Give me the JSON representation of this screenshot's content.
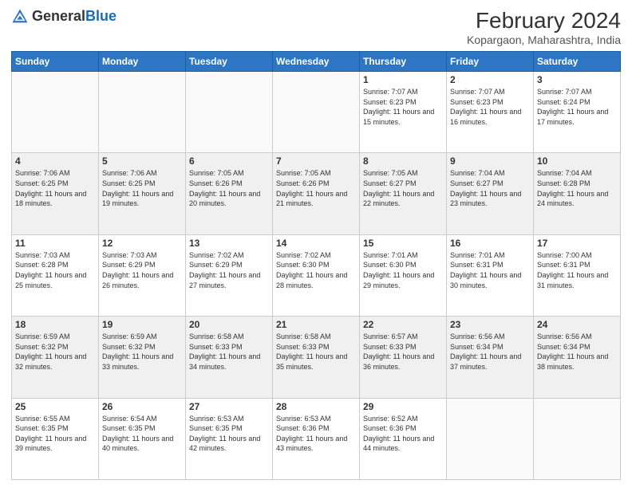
{
  "header": {
    "logo_general": "General",
    "logo_blue": "Blue",
    "month_year": "February 2024",
    "location": "Kopargaon, Maharashtra, India"
  },
  "weekdays": [
    "Sunday",
    "Monday",
    "Tuesday",
    "Wednesday",
    "Thursday",
    "Friday",
    "Saturday"
  ],
  "weeks": [
    [
      {
        "day": "",
        "info": ""
      },
      {
        "day": "",
        "info": ""
      },
      {
        "day": "",
        "info": ""
      },
      {
        "day": "",
        "info": ""
      },
      {
        "day": "1",
        "info": "Sunrise: 7:07 AM\nSunset: 6:23 PM\nDaylight: 11 hours and 15 minutes."
      },
      {
        "day": "2",
        "info": "Sunrise: 7:07 AM\nSunset: 6:23 PM\nDaylight: 11 hours and 16 minutes."
      },
      {
        "day": "3",
        "info": "Sunrise: 7:07 AM\nSunset: 6:24 PM\nDaylight: 11 hours and 17 minutes."
      }
    ],
    [
      {
        "day": "4",
        "info": "Sunrise: 7:06 AM\nSunset: 6:25 PM\nDaylight: 11 hours and 18 minutes."
      },
      {
        "day": "5",
        "info": "Sunrise: 7:06 AM\nSunset: 6:25 PM\nDaylight: 11 hours and 19 minutes."
      },
      {
        "day": "6",
        "info": "Sunrise: 7:05 AM\nSunset: 6:26 PM\nDaylight: 11 hours and 20 minutes."
      },
      {
        "day": "7",
        "info": "Sunrise: 7:05 AM\nSunset: 6:26 PM\nDaylight: 11 hours and 21 minutes."
      },
      {
        "day": "8",
        "info": "Sunrise: 7:05 AM\nSunset: 6:27 PM\nDaylight: 11 hours and 22 minutes."
      },
      {
        "day": "9",
        "info": "Sunrise: 7:04 AM\nSunset: 6:27 PM\nDaylight: 11 hours and 23 minutes."
      },
      {
        "day": "10",
        "info": "Sunrise: 7:04 AM\nSunset: 6:28 PM\nDaylight: 11 hours and 24 minutes."
      }
    ],
    [
      {
        "day": "11",
        "info": "Sunrise: 7:03 AM\nSunset: 6:28 PM\nDaylight: 11 hours and 25 minutes."
      },
      {
        "day": "12",
        "info": "Sunrise: 7:03 AM\nSunset: 6:29 PM\nDaylight: 11 hours and 26 minutes."
      },
      {
        "day": "13",
        "info": "Sunrise: 7:02 AM\nSunset: 6:29 PM\nDaylight: 11 hours and 27 minutes."
      },
      {
        "day": "14",
        "info": "Sunrise: 7:02 AM\nSunset: 6:30 PM\nDaylight: 11 hours and 28 minutes."
      },
      {
        "day": "15",
        "info": "Sunrise: 7:01 AM\nSunset: 6:30 PM\nDaylight: 11 hours and 29 minutes."
      },
      {
        "day": "16",
        "info": "Sunrise: 7:01 AM\nSunset: 6:31 PM\nDaylight: 11 hours and 30 minutes."
      },
      {
        "day": "17",
        "info": "Sunrise: 7:00 AM\nSunset: 6:31 PM\nDaylight: 11 hours and 31 minutes."
      }
    ],
    [
      {
        "day": "18",
        "info": "Sunrise: 6:59 AM\nSunset: 6:32 PM\nDaylight: 11 hours and 32 minutes."
      },
      {
        "day": "19",
        "info": "Sunrise: 6:59 AM\nSunset: 6:32 PM\nDaylight: 11 hours and 33 minutes."
      },
      {
        "day": "20",
        "info": "Sunrise: 6:58 AM\nSunset: 6:33 PM\nDaylight: 11 hours and 34 minutes."
      },
      {
        "day": "21",
        "info": "Sunrise: 6:58 AM\nSunset: 6:33 PM\nDaylight: 11 hours and 35 minutes."
      },
      {
        "day": "22",
        "info": "Sunrise: 6:57 AM\nSunset: 6:33 PM\nDaylight: 11 hours and 36 minutes."
      },
      {
        "day": "23",
        "info": "Sunrise: 6:56 AM\nSunset: 6:34 PM\nDaylight: 11 hours and 37 minutes."
      },
      {
        "day": "24",
        "info": "Sunrise: 6:56 AM\nSunset: 6:34 PM\nDaylight: 11 hours and 38 minutes."
      }
    ],
    [
      {
        "day": "25",
        "info": "Sunrise: 6:55 AM\nSunset: 6:35 PM\nDaylight: 11 hours and 39 minutes."
      },
      {
        "day": "26",
        "info": "Sunrise: 6:54 AM\nSunset: 6:35 PM\nDaylight: 11 hours and 40 minutes."
      },
      {
        "day": "27",
        "info": "Sunrise: 6:53 AM\nSunset: 6:35 PM\nDaylight: 11 hours and 42 minutes."
      },
      {
        "day": "28",
        "info": "Sunrise: 6:53 AM\nSunset: 6:36 PM\nDaylight: 11 hours and 43 minutes."
      },
      {
        "day": "29",
        "info": "Sunrise: 6:52 AM\nSunset: 6:36 PM\nDaylight: 11 hours and 44 minutes."
      },
      {
        "day": "",
        "info": ""
      },
      {
        "day": "",
        "info": ""
      }
    ]
  ]
}
